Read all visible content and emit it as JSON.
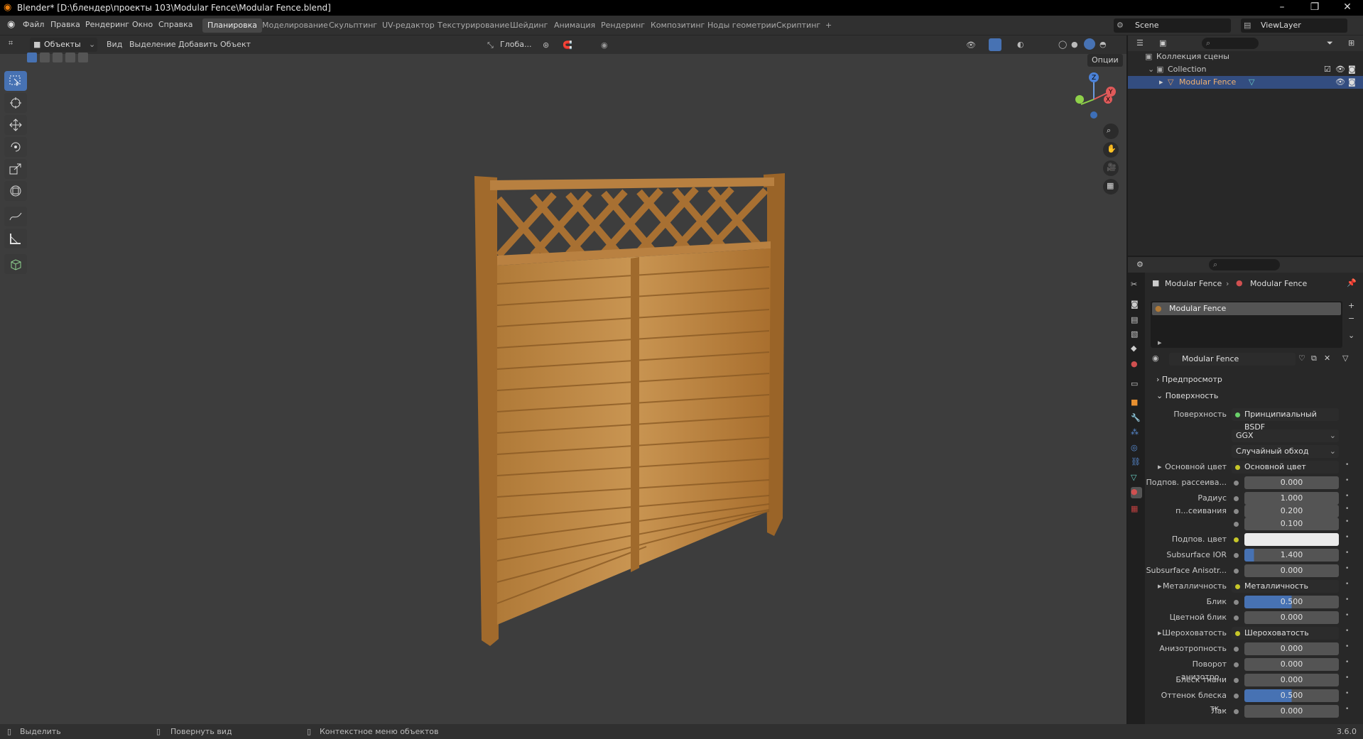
{
  "title": "Blender* [D:\\блендер\\проекты 103\\Modular Fence\\Modular Fence.blend]",
  "menus": [
    "Файл",
    "Правка",
    "Рендеринг",
    "Окно",
    "Справка"
  ],
  "workspaces": [
    "Планировка",
    "Моделирование",
    "Скульптинг",
    "UV-редактор",
    "Текстурирование",
    "Шейдинг",
    "Анимация",
    "Рендеринг",
    "Композитинг",
    "Ноды геометрии",
    "Скриптинг",
    "+"
  ],
  "scene": "Scene",
  "view_layer": "ViewLayer",
  "viewport": {
    "mode": "Объекты",
    "menu": [
      "Вид",
      "Выделение",
      "Добавить",
      "Объект"
    ],
    "transform": "Глоба...",
    "options": "Опции"
  },
  "outliner": {
    "rows": [
      "Коллекция сцены",
      "Collection",
      "Modular Fence"
    ]
  },
  "properties": {
    "breadcrumb_object": "Modular Fence",
    "breadcrumb_material": "Modular Fence",
    "slot": "Modular Fence",
    "material_name": "Modular Fence",
    "sections": {
      "preview": "Предпросмотр",
      "surface": "Поверхность"
    },
    "surface_label": "Поверхность",
    "surface_value": "Принципиальный BSDF",
    "distribution": "GGX",
    "subsurface_method": "Случайный обход",
    "rows": [
      {
        "label": "Основной цвет",
        "value": "Основной цвет",
        "kind": "link",
        "expand": true
      },
      {
        "label": "Подпов. рассеива...",
        "value": "0.000",
        "kind": "num"
      },
      {
        "label": "Радиус п...сеивания",
        "value": "1.000",
        "kind": "num"
      },
      {
        "label": "",
        "value": "0.200",
        "kind": "num"
      },
      {
        "label": "",
        "value": "0.100",
        "kind": "num"
      },
      {
        "label": "Подпов. цвет",
        "value": "",
        "kind": "color"
      },
      {
        "label": "Subsurface IOR",
        "value": "1.400",
        "kind": "num",
        "fill": 0.1
      },
      {
        "label": "Subsurface Anisotr...",
        "value": "0.000",
        "kind": "num"
      },
      {
        "label": "Металличность",
        "value": "Металличность",
        "kind": "link",
        "expand": true
      },
      {
        "label": "Блик",
        "value": "0.500",
        "kind": "num",
        "fill": 0.5
      },
      {
        "label": "Цветной блик",
        "value": "0.000",
        "kind": "num"
      },
      {
        "label": "Шероховатость",
        "value": "Шероховатость",
        "kind": "link",
        "expand": true
      },
      {
        "label": "Анизотропность",
        "value": "0.000",
        "kind": "num"
      },
      {
        "label": "Поворот анизотро...",
        "value": "0.000",
        "kind": "num"
      },
      {
        "label": "Блеск ткани",
        "value": "0.000",
        "kind": "num"
      },
      {
        "label": "Оттенок блеска тк...",
        "value": "0.500",
        "kind": "num",
        "fill": 0.5
      },
      {
        "label": "Лак",
        "value": "0.000",
        "kind": "num"
      }
    ]
  },
  "status": {
    "select": "Выделить",
    "rotate": "Повернуть вид",
    "context": "Контекстное меню объектов",
    "version": "3.6.0"
  }
}
